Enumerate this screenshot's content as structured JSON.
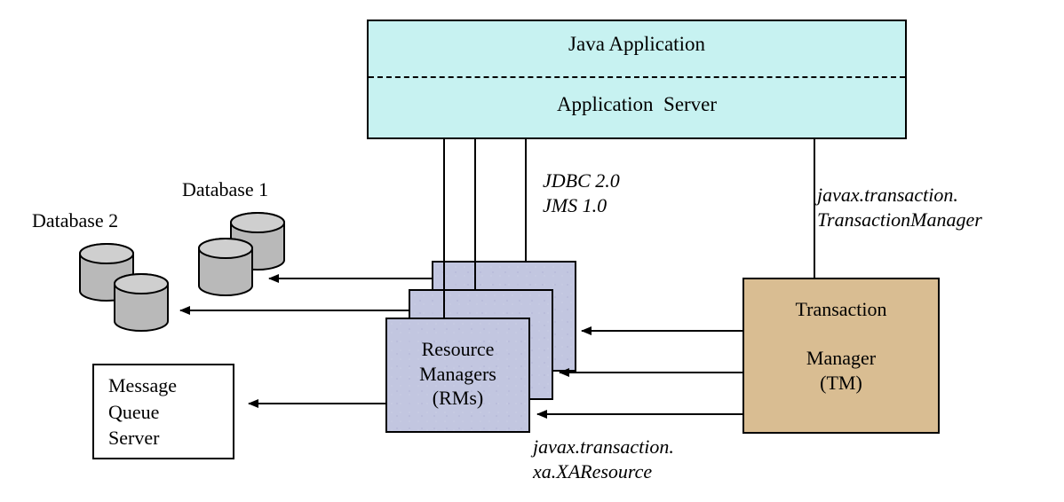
{
  "top": {
    "java_app": "Java Application",
    "app_server": "Application  Server"
  },
  "db1_label": "Database 1",
  "db2_label": "Database 2",
  "jdbc_jms": "JDBC 2.0\nJMS 1.0",
  "tm_api": "javax.transaction.\nTransactionManager",
  "rm_box": "Resource\nManagers\n(RMs)",
  "tm_box": "Transaction\n\nManager\n(TM)",
  "xa_api": "javax.transaction.\nxa.XAResource",
  "mq_box": "Message\nQueue\nServer"
}
